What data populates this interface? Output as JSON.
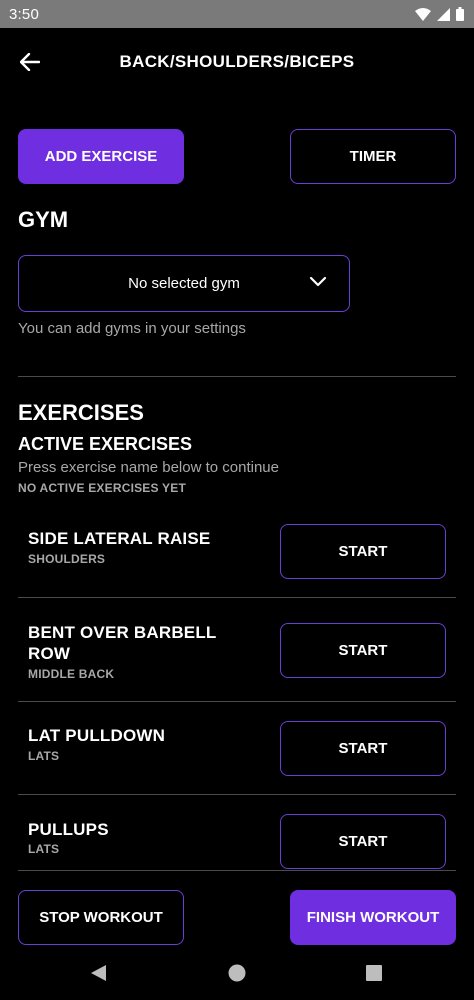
{
  "status": {
    "time": "3:50"
  },
  "appbar": {
    "title": "BACK/SHOULDERS/BICEPS"
  },
  "actions": {
    "add_exercise": "ADD EXERCISE",
    "timer": "TIMER"
  },
  "gym": {
    "heading": "GYM",
    "selected": "No selected gym",
    "hint": "You can add gyms in your settings"
  },
  "exercises": {
    "heading": "EXERCISES",
    "active_heading": "ACTIVE EXERCISES",
    "active_hint": "Press exercise name below to continue",
    "active_empty": "NO ACTIVE EXERCISES YET",
    "items": [
      {
        "name": "SIDE LATERAL RAISE",
        "muscle": "SHOULDERS",
        "action": "START"
      },
      {
        "name": "BENT OVER BARBELL ROW",
        "muscle": "MIDDLE BACK",
        "action": "START"
      },
      {
        "name": "LAT PULLDOWN",
        "muscle": "LATS",
        "action": "START"
      },
      {
        "name": "PULLUPS",
        "muscle": "LATS",
        "action": "START"
      }
    ]
  },
  "footer": {
    "stop": "STOP WORKOUT",
    "finish": "FINISH WORKOUT"
  },
  "colors": {
    "accent": "#6f2ee0",
    "outline": "#6b3fd6",
    "muted": "#a8a8a8"
  }
}
